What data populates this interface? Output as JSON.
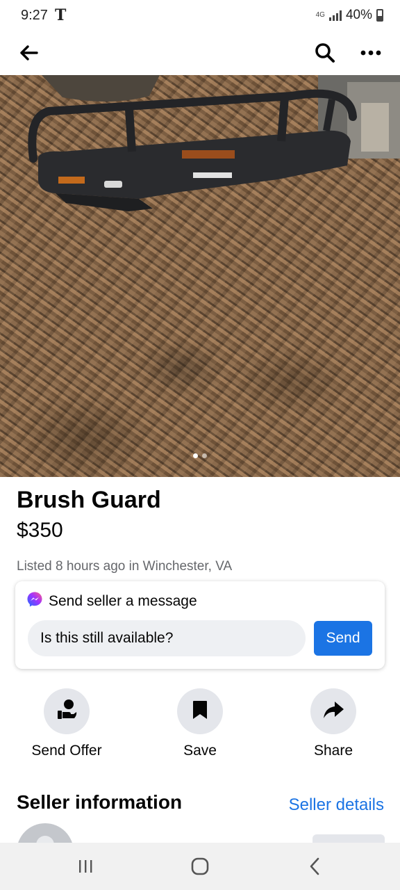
{
  "status_bar": {
    "time": "9:27",
    "carrier": "T",
    "network": "4G",
    "battery": "40%"
  },
  "app_bar": {
    "back_icon": "arrow-left-icon",
    "search_icon": "search-icon",
    "more_icon": "more-horizontal-icon"
  },
  "listing": {
    "image_dots": {
      "count": 2,
      "active": 1
    },
    "title": "Brush Guard",
    "price": "$350",
    "meta": "Listed 8 hours ago in Winchester, VA"
  },
  "message_card": {
    "icon": "messenger-icon",
    "heading": "Send seller a message",
    "input_value": "Is this still available?",
    "send_label": "Send"
  },
  "actions": [
    {
      "label": "Send Offer",
      "icon": "hand-coin-icon"
    },
    {
      "label": "Save",
      "icon": "bookmark-icon"
    },
    {
      "label": "Share",
      "icon": "share-arrow-icon"
    }
  ],
  "seller": {
    "heading": "Seller information",
    "details_link": "Seller details"
  },
  "nav_bar": {
    "recents_icon": "recents-icon",
    "home_icon": "home-icon",
    "back_icon": "back-chevron-icon"
  },
  "colors": {
    "accent": "#1b74e4",
    "icon_bg": "#e4e6eb",
    "secondary_text": "#65676b"
  }
}
